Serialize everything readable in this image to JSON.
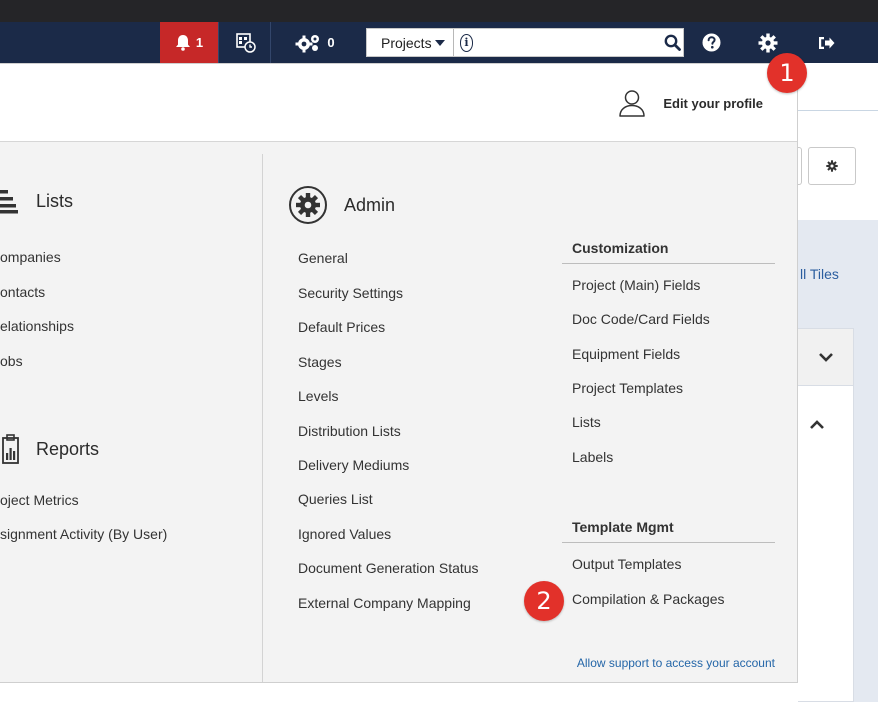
{
  "topbar": {
    "alert_count": "1",
    "background_jobs_count": "0",
    "search": {
      "scope": "Projects",
      "placeholder": ""
    }
  },
  "profile": {
    "label": "Edit your profile"
  },
  "lists": {
    "title": "Lists",
    "items": [
      "ompanies",
      "ontacts",
      "elationships",
      "obs"
    ]
  },
  "reports": {
    "title": "Reports",
    "items": [
      "oject Metrics",
      "signment Activity (By User)"
    ]
  },
  "admin": {
    "title": "Admin",
    "items": [
      "General",
      "Security Settings",
      "Default Prices",
      "Stages",
      "Levels",
      "Distribution Lists",
      "Delivery Mediums",
      "Queries List",
      "Ignored Values",
      "Document Generation Status",
      "External Company Mapping"
    ]
  },
  "customization": {
    "title": "Customization",
    "items": [
      "Project (Main) Fields",
      "Doc Code/Card Fields",
      "Equipment Fields",
      "Project Templates",
      "Lists",
      "Labels"
    ]
  },
  "template_mgmt": {
    "title": "Template Mgmt",
    "items": [
      "Output Templates",
      "Compilation & Packages"
    ]
  },
  "support_link": "Allow support to access your account",
  "background": {
    "tiles_label": "ll Tiles"
  },
  "markers": [
    "1",
    "2"
  ],
  "colors": {
    "topbar": "#1b2a48",
    "alert": "#c62828",
    "marker": "#e2312a",
    "link": "#2466a8"
  }
}
